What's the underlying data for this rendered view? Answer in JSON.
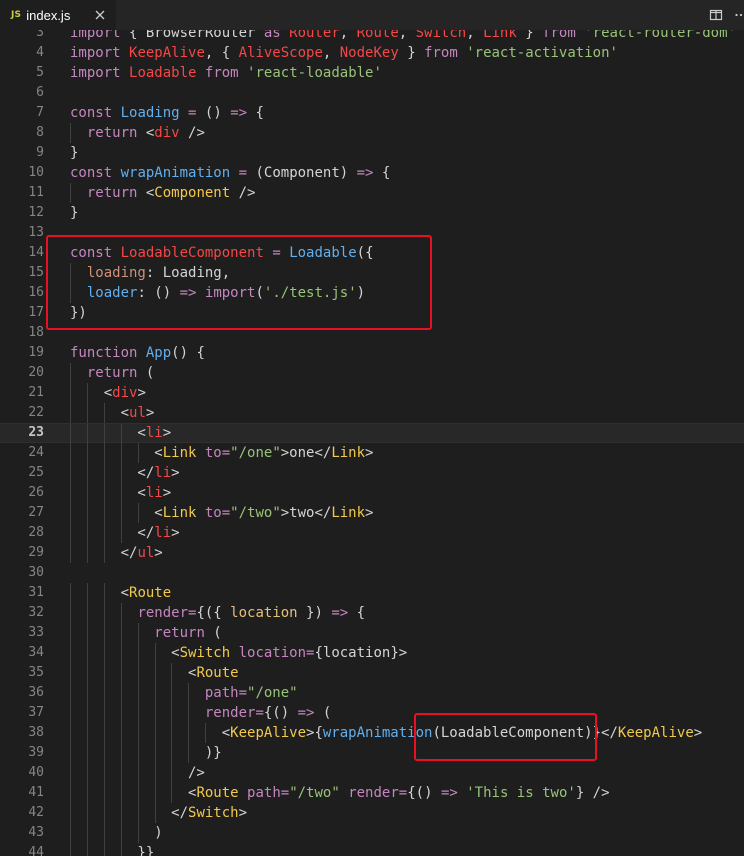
{
  "tab": {
    "icon_label": "JS",
    "filename": "index.js"
  },
  "icons": {
    "close": "close-icon",
    "split": "split-editor-icon",
    "more": "more-actions-icon"
  },
  "colors": {
    "background": "#1e1e1e",
    "tabbar": "#252526",
    "highlight_box": "#e81123"
  },
  "editor": {
    "current_line": 23,
    "lines": [
      {
        "n": "3",
        "tokens": [
          [
            "kw",
            "import"
          ],
          [
            "pl",
            " { BrowserRouter "
          ],
          [
            "kw",
            "as"
          ],
          [
            "pl",
            " "
          ],
          [
            "tg",
            "Router"
          ],
          [
            "pl",
            ", "
          ],
          [
            "tg",
            "Route"
          ],
          [
            "pl",
            ", "
          ],
          [
            "tg",
            "Switch"
          ],
          [
            "pl",
            ", "
          ],
          [
            "tg",
            "Link"
          ],
          [
            "pl",
            " } "
          ],
          [
            "kw",
            "from"
          ],
          [
            "pl",
            " "
          ],
          [
            "gr",
            "'react-router-dom'"
          ]
        ]
      },
      {
        "n": "4",
        "tokens": [
          [
            "kw",
            "import"
          ],
          [
            "pl",
            " "
          ],
          [
            "tg",
            "KeepAlive"
          ],
          [
            "pl",
            ", { "
          ],
          [
            "tg",
            "AliveScope"
          ],
          [
            "pl",
            ", "
          ],
          [
            "tg",
            "NodeKey"
          ],
          [
            "pl",
            " } "
          ],
          [
            "kw",
            "from"
          ],
          [
            "pl",
            " "
          ],
          [
            "gr",
            "'react-activation'"
          ]
        ]
      },
      {
        "n": "5",
        "tokens": [
          [
            "kw",
            "import"
          ],
          [
            "pl",
            " "
          ],
          [
            "tg",
            "Loadable"
          ],
          [
            "pl",
            " "
          ],
          [
            "kw",
            "from"
          ],
          [
            "pl",
            " "
          ],
          [
            "gr",
            "'react-loadable'"
          ]
        ]
      },
      {
        "n": "6",
        "tokens": []
      },
      {
        "n": "7",
        "tokens": [
          [
            "kw",
            "const"
          ],
          [
            "pl",
            " "
          ],
          [
            "fn",
            "Loading"
          ],
          [
            "pl",
            " "
          ],
          [
            "op",
            "="
          ],
          [
            "pl",
            " () "
          ],
          [
            "op",
            "=>"
          ],
          [
            "pl",
            " {"
          ]
        ]
      },
      {
        "n": "8",
        "tokens": [
          [
            "pl",
            "  "
          ],
          [
            "kw",
            "return"
          ],
          [
            "pl",
            " <"
          ],
          [
            "tg",
            "div"
          ],
          [
            "pl",
            " />"
          ]
        ]
      },
      {
        "n": "9",
        "tokens": [
          [
            "pl",
            "}"
          ]
        ]
      },
      {
        "n": "10",
        "tokens": [
          [
            "kw",
            "const"
          ],
          [
            "pl",
            " "
          ],
          [
            "fn",
            "wrapAnimation"
          ],
          [
            "pl",
            " "
          ],
          [
            "op",
            "="
          ],
          [
            "pl",
            " (Component) "
          ],
          [
            "op",
            "=>"
          ],
          [
            "pl",
            " {"
          ]
        ]
      },
      {
        "n": "11",
        "tokens": [
          [
            "pl",
            "  "
          ],
          [
            "kw",
            "return"
          ],
          [
            "pl",
            " <"
          ],
          [
            "jsx",
            "Component"
          ],
          [
            "pl",
            " />"
          ]
        ]
      },
      {
        "n": "12",
        "tokens": [
          [
            "pl",
            "}"
          ]
        ]
      },
      {
        "n": "13",
        "tokens": []
      },
      {
        "n": "14",
        "tokens": [
          [
            "kw",
            "const"
          ],
          [
            "pl",
            " "
          ],
          [
            "tg",
            "LoadableComponent"
          ],
          [
            "pl",
            " "
          ],
          [
            "op",
            "="
          ],
          [
            "pl",
            " "
          ],
          [
            "fn",
            "Loadable"
          ],
          [
            "pl",
            "({"
          ]
        ]
      },
      {
        "n": "15",
        "tokens": [
          [
            "pl",
            "  "
          ],
          [
            "st",
            "loading"
          ],
          [
            "pl",
            ": Loading,"
          ]
        ]
      },
      {
        "n": "16",
        "tokens": [
          [
            "pl",
            "  "
          ],
          [
            "fn",
            "loader"
          ],
          [
            "pl",
            ": () "
          ],
          [
            "op",
            "=>"
          ],
          [
            "pl",
            " "
          ],
          [
            "kw",
            "import"
          ],
          [
            "pl",
            "("
          ],
          [
            "gr",
            "'./test.js'"
          ],
          [
            "pl",
            ")"
          ]
        ]
      },
      {
        "n": "17",
        "tokens": [
          [
            "pl",
            "})"
          ]
        ]
      },
      {
        "n": "18",
        "tokens": []
      },
      {
        "n": "19",
        "tokens": [
          [
            "kw",
            "function"
          ],
          [
            "pl",
            " "
          ],
          [
            "fn",
            "App"
          ],
          [
            "pl",
            "() {"
          ]
        ]
      },
      {
        "n": "20",
        "tokens": [
          [
            "pl",
            "  "
          ],
          [
            "kw",
            "return"
          ],
          [
            "pl",
            " ("
          ]
        ]
      },
      {
        "n": "21",
        "tokens": [
          [
            "pl",
            "    <"
          ],
          [
            "tg",
            "div"
          ],
          [
            "pl",
            ">"
          ]
        ]
      },
      {
        "n": "22",
        "tokens": [
          [
            "pl",
            "      <"
          ],
          [
            "tg",
            "ul"
          ],
          [
            "pl",
            ">"
          ]
        ]
      },
      {
        "n": "23",
        "tokens": [
          [
            "pl",
            "        <"
          ],
          [
            "tg",
            "li"
          ],
          [
            "pl",
            ">"
          ]
        ]
      },
      {
        "n": "24",
        "tokens": [
          [
            "pl",
            "          <"
          ],
          [
            "jsx",
            "Link"
          ],
          [
            "pl",
            " "
          ],
          [
            "at",
            "to"
          ],
          [
            "op",
            "="
          ],
          [
            "gr",
            "\"/one\""
          ],
          [
            "pl",
            ">one</"
          ],
          [
            "jsx",
            "Link"
          ],
          [
            "pl",
            ">"
          ]
        ]
      },
      {
        "n": "25",
        "tokens": [
          [
            "pl",
            "        </"
          ],
          [
            "tg",
            "li"
          ],
          [
            "pl",
            ">"
          ]
        ]
      },
      {
        "n": "26",
        "tokens": [
          [
            "pl",
            "        <"
          ],
          [
            "tg",
            "li"
          ],
          [
            "pl",
            ">"
          ]
        ]
      },
      {
        "n": "27",
        "tokens": [
          [
            "pl",
            "          <"
          ],
          [
            "jsx",
            "Link"
          ],
          [
            "pl",
            " "
          ],
          [
            "at",
            "to"
          ],
          [
            "op",
            "="
          ],
          [
            "gr",
            "\"/two\""
          ],
          [
            "pl",
            ">two</"
          ],
          [
            "jsx",
            "Link"
          ],
          [
            "pl",
            ">"
          ]
        ]
      },
      {
        "n": "28",
        "tokens": [
          [
            "pl",
            "        </"
          ],
          [
            "tg",
            "li"
          ],
          [
            "pl",
            ">"
          ]
        ]
      },
      {
        "n": "29",
        "tokens": [
          [
            "pl",
            "      </"
          ],
          [
            "tg",
            "ul"
          ],
          [
            "pl",
            ">"
          ]
        ]
      },
      {
        "n": "30",
        "tokens": []
      },
      {
        "n": "31",
        "tokens": [
          [
            "pl",
            "      <"
          ],
          [
            "jsx",
            "Route"
          ]
        ]
      },
      {
        "n": "32",
        "tokens": [
          [
            "pl",
            "        "
          ],
          [
            "at",
            "render"
          ],
          [
            "op",
            "="
          ],
          [
            "pl",
            "{({ "
          ],
          [
            "co",
            "location"
          ],
          [
            "pl",
            " }) "
          ],
          [
            "op",
            "=>"
          ],
          [
            "pl",
            " {"
          ]
        ]
      },
      {
        "n": "33",
        "tokens": [
          [
            "pl",
            "          "
          ],
          [
            "kw",
            "return"
          ],
          [
            "pl",
            " ("
          ]
        ]
      },
      {
        "n": "34",
        "tokens": [
          [
            "pl",
            "            <"
          ],
          [
            "jsx",
            "Switch"
          ],
          [
            "pl",
            " "
          ],
          [
            "at",
            "location"
          ],
          [
            "op",
            "="
          ],
          [
            "pl",
            "{location}>"
          ]
        ]
      },
      {
        "n": "35",
        "tokens": [
          [
            "pl",
            "              <"
          ],
          [
            "jsx",
            "Route"
          ]
        ]
      },
      {
        "n": "36",
        "tokens": [
          [
            "pl",
            "                "
          ],
          [
            "at",
            "path"
          ],
          [
            "op",
            "="
          ],
          [
            "gr",
            "\"/one\""
          ]
        ]
      },
      {
        "n": "37",
        "tokens": [
          [
            "pl",
            "                "
          ],
          [
            "at",
            "render"
          ],
          [
            "op",
            "="
          ],
          [
            "pl",
            "{() "
          ],
          [
            "op",
            "=>"
          ],
          [
            "pl",
            " ("
          ]
        ]
      },
      {
        "n": "38",
        "tokens": [
          [
            "pl",
            "                  <"
          ],
          [
            "jsx",
            "KeepAlive"
          ],
          [
            "pl",
            ">{"
          ],
          [
            "fn",
            "wrapAnimation"
          ],
          [
            "pl",
            "(LoadableComponent)}</"
          ],
          [
            "jsx",
            "KeepAlive"
          ],
          [
            "pl",
            ">"
          ]
        ]
      },
      {
        "n": "39",
        "tokens": [
          [
            "pl",
            "                )}"
          ]
        ]
      },
      {
        "n": "40",
        "tokens": [
          [
            "pl",
            "              />"
          ]
        ]
      },
      {
        "n": "41",
        "tokens": [
          [
            "pl",
            "              <"
          ],
          [
            "jsx",
            "Route"
          ],
          [
            "pl",
            " "
          ],
          [
            "at",
            "path"
          ],
          [
            "op",
            "="
          ],
          [
            "gr",
            "\"/two\""
          ],
          [
            "pl",
            " "
          ],
          [
            "at",
            "render"
          ],
          [
            "op",
            "="
          ],
          [
            "pl",
            "{() "
          ],
          [
            "op",
            "=>"
          ],
          [
            "pl",
            " "
          ],
          [
            "gr",
            "'This is two'"
          ],
          [
            "pl",
            "} />"
          ]
        ]
      },
      {
        "n": "42",
        "tokens": [
          [
            "pl",
            "            </"
          ],
          [
            "jsx",
            "Switch"
          ],
          [
            "pl",
            ">"
          ]
        ]
      },
      {
        "n": "43",
        "tokens": [
          [
            "pl",
            "          )"
          ]
        ]
      },
      {
        "n": "44",
        "tokens": [
          [
            "pl",
            "        }}"
          ]
        ]
      }
    ]
  }
}
